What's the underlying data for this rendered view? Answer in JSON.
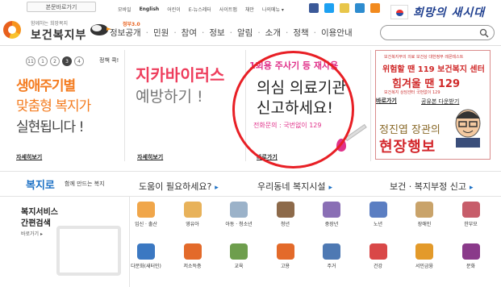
{
  "header": {
    "skip_label": "본문바로가기",
    "util_links": [
      "모바일",
      "English",
      "어린이",
      "E-뉴스레터",
      "사이트맵",
      "채만",
      "나의메뉴 ▾"
    ],
    "slogan": "희망의 새시대",
    "site_sub": "함께하는 희망복지",
    "site_name": "보건복지부",
    "gnb_sup": "정부3.0",
    "gnb": [
      "정보공개",
      "민원",
      "참여",
      "정보",
      "알림",
      "소개",
      "정책",
      "이용안내"
    ],
    "search_placeholder": ""
  },
  "panel1": {
    "pager": [
      "11",
      "1",
      "2",
      "3",
      "4"
    ],
    "policy_label": "정책 콕!",
    "line1": "생애주기별",
    "line2": "맞춤형 복지가",
    "line3": "실현됩니다 !",
    "more": "자세히보기"
  },
  "panel2": {
    "line1": "지카바이러스",
    "line2": "예방하기 !",
    "more": "자세히보기"
  },
  "panel3": {
    "line1": "1회용 주사기 등 재사용",
    "line2": "의심 의료기관",
    "line3": "신고하세요!",
    "line4": "전화문의 : 국번없이 129",
    "more": "바로가기"
  },
  "panel4": {
    "top": "보건복지부의 의료 보건상 대한정부 레몬테스트",
    "a": "위험할 땐 119 보건복지 센터",
    "b": "힘겨울 땐 129",
    "c": "보건복지 상담센터 국번없이 129",
    "more": "바로가기",
    "download": "공유본 다운받기",
    "minister": "정진엽 장관의",
    "field": "현장행보"
  },
  "band": {
    "logo": "복지로",
    "sub": "함께 만드는 복지",
    "h1": "도움이 필요하세요?",
    "h2": "우리동네 복지시설",
    "h3": "보건 · 복지부정 신고"
  },
  "left": {
    "t1": "복지서비스",
    "t2": "간편검색",
    "more": "바로가기 ▸"
  },
  "icons": [
    {
      "label": "임신 · 출산",
      "color": "#f0a64a"
    },
    {
      "label": "영유아",
      "color": "#e8b25a"
    },
    {
      "label": "아동 · 청소년",
      "color": "#9bb2c9"
    },
    {
      "label": "청년",
      "color": "#8d6a4a"
    },
    {
      "label": "중장년",
      "color": "#8a6fb5"
    },
    {
      "label": "노년",
      "color": "#5b7ec2"
    },
    {
      "label": "장애인",
      "color": "#c9a36a"
    },
    {
      "label": "한부모",
      "color": "#c75d6a"
    },
    {
      "label": "다문화(새터민)",
      "color": "#3b78c2"
    },
    {
      "label": "저소득층",
      "color": "#e36a2a"
    },
    {
      "label": "교육",
      "color": "#6e9e4d"
    },
    {
      "label": "고용",
      "color": "#e36a2a"
    },
    {
      "label": "주거",
      "color": "#4e79b3"
    },
    {
      "label": "건강",
      "color": "#d94848"
    },
    {
      "label": "서민금융",
      "color": "#e39a2a"
    },
    {
      "label": "문화",
      "color": "#8a3a8a"
    }
  ]
}
